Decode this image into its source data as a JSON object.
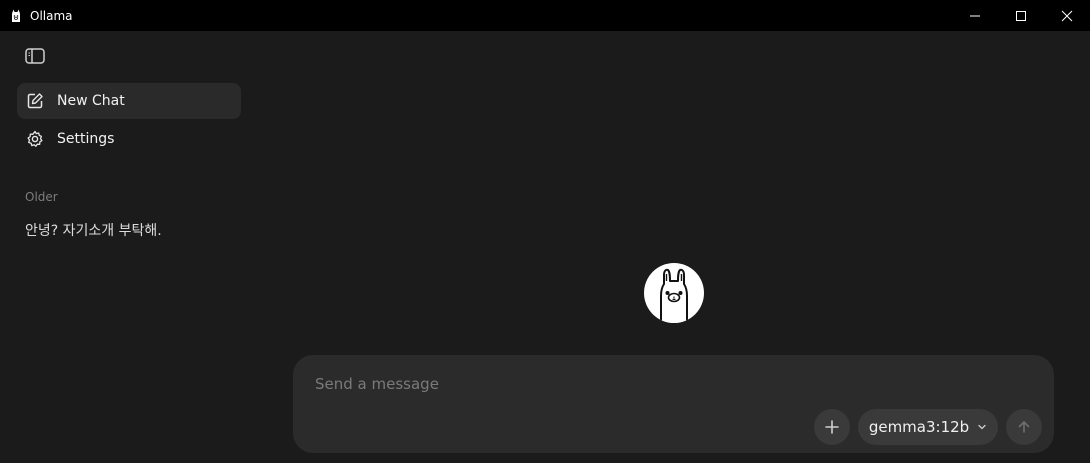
{
  "window": {
    "title": "Ollama",
    "app_icon": "ollama-llama-icon"
  },
  "sidebar": {
    "toggle_icon": "sidebar-toggle-icon",
    "items": [
      {
        "label": "New Chat",
        "icon": "new-chat-icon",
        "active": true
      },
      {
        "label": "Settings",
        "icon": "gear-icon",
        "active": false
      }
    ],
    "section_label": "Older",
    "history": [
      "안녕? 자기소개 부탁해."
    ]
  },
  "composer": {
    "placeholder": "Send a message",
    "value": "",
    "attach_icon": "plus-icon",
    "model": "gemma3:12b",
    "send_icon": "arrow-up-icon"
  },
  "colors": {
    "titlebar": "#000000",
    "background": "#1b1b1b",
    "active_item": "#2a2a2a",
    "composer": "#2b2b2b",
    "pill": "#3a3a3a"
  }
}
